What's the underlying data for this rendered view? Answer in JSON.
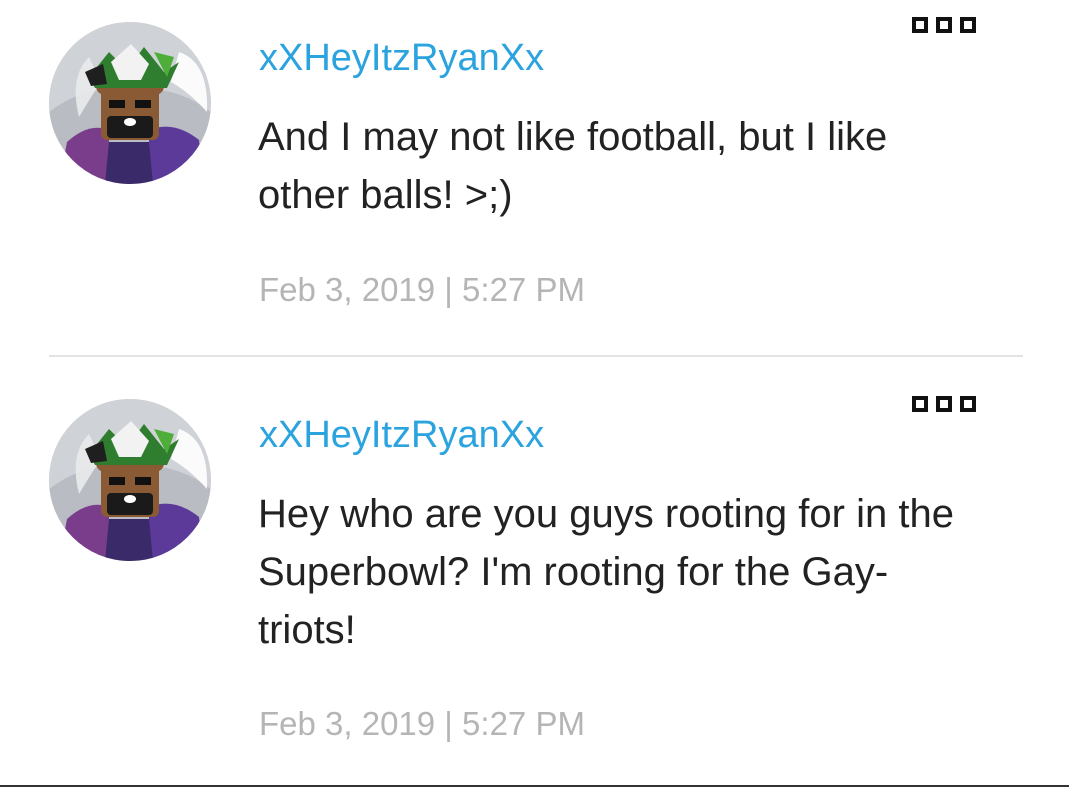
{
  "comments": [
    {
      "username": "xXHeyItzRyanXx",
      "message_lines": [
        "And I may not like football, but I like",
        "other balls! >;)"
      ],
      "timestamp": "Feb 3, 2019 | 5:27 PM",
      "avatar_icon": "roblox-avatar-bear-mask"
    },
    {
      "username": "xXHeyItzRyanXx",
      "message_lines": [
        "Hey who are you guys rooting for in the",
        "Superbowl? I'm rooting for the Gay-",
        "triots!"
      ],
      "timestamp": "Feb 3, 2019 | 5:27 PM",
      "avatar_icon": "roblox-avatar-bear-mask"
    }
  ],
  "menu_icon": "more-options-icon",
  "colors": {
    "username": "#2aa3de",
    "message": "#222222",
    "timestamp": "#b5b5b5",
    "divider": "#e3e3e3"
  }
}
